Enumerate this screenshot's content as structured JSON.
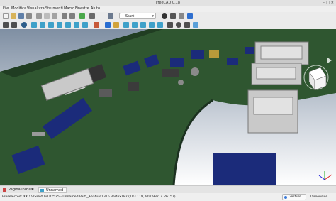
{
  "window": {
    "title": "FreeCAD 0.18"
  },
  "menu": [
    "File",
    "Modifica",
    "Visualizza",
    "Strumenti",
    "Macro",
    "Finestre",
    "Aiuto"
  ],
  "toolbar": {
    "workbench_label": "Start"
  },
  "tabs": [
    {
      "label": "Pagina iniziale",
      "icon": "start-page-icon"
    },
    {
      "label": "Unnamed : 1*",
      "icon": "document-icon"
    }
  ],
  "status": {
    "message": "Preselected: XXD VISHAY IHLP2525 - Unnamed.Part__Feature1316.Vertex182 (183.119, 90.0937, 4.26157)",
    "nav_style": "Gesture",
    "dimensions": "Dimension"
  },
  "colors": {
    "pcb": "#2f5630",
    "chip": "#1b2b7a",
    "connector": "#c9c9c9",
    "background_top": "#7f8fa3",
    "background_bottom": "#ffffff"
  }
}
